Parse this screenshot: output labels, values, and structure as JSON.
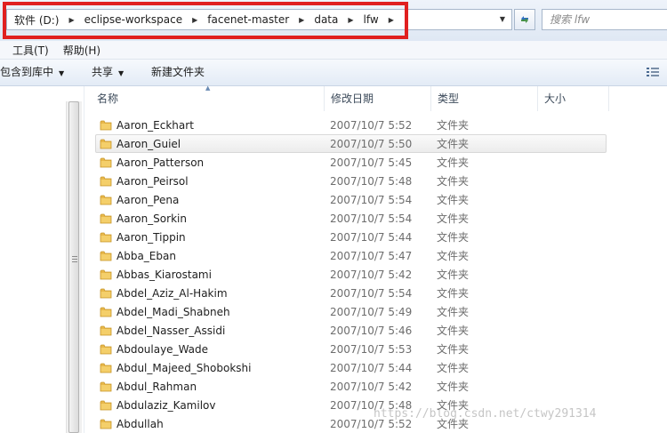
{
  "address_bar": {
    "breadcrumbs": [
      "软件 (D:)",
      "eclipse-workspace",
      "facenet-master",
      "data",
      "lfw"
    ]
  },
  "search": {
    "placeholder": "搜索 lfw"
  },
  "menu": {
    "items": [
      "工具(T)",
      "帮助(H)"
    ]
  },
  "toolbar": {
    "include_library": "包含到库中",
    "share": "共享",
    "new_folder": "新建文件夹"
  },
  "columns": {
    "name": "名称",
    "date": "修改日期",
    "type": "类型",
    "size": "大小"
  },
  "files": [
    {
      "name": "Aaron_Eckhart",
      "date": "2007/10/7 5:52",
      "type": "文件夹"
    },
    {
      "name": "Aaron_Guiel",
      "date": "2007/10/7 5:50",
      "type": "文件夹"
    },
    {
      "name": "Aaron_Patterson",
      "date": "2007/10/7 5:45",
      "type": "文件夹"
    },
    {
      "name": "Aaron_Peirsol",
      "date": "2007/10/7 5:48",
      "type": "文件夹"
    },
    {
      "name": "Aaron_Pena",
      "date": "2007/10/7 5:54",
      "type": "文件夹"
    },
    {
      "name": "Aaron_Sorkin",
      "date": "2007/10/7 5:54",
      "type": "文件夹"
    },
    {
      "name": "Aaron_Tippin",
      "date": "2007/10/7 5:44",
      "type": "文件夹"
    },
    {
      "name": "Abba_Eban",
      "date": "2007/10/7 5:47",
      "type": "文件夹"
    },
    {
      "name": "Abbas_Kiarostami",
      "date": "2007/10/7 5:42",
      "type": "文件夹"
    },
    {
      "name": "Abdel_Aziz_Al-Hakim",
      "date": "2007/10/7 5:54",
      "type": "文件夹"
    },
    {
      "name": "Abdel_Madi_Shabneh",
      "date": "2007/10/7 5:49",
      "type": "文件夹"
    },
    {
      "name": "Abdel_Nasser_Assidi",
      "date": "2007/10/7 5:46",
      "type": "文件夹"
    },
    {
      "name": "Abdoulaye_Wade",
      "date": "2007/10/7 5:53",
      "type": "文件夹"
    },
    {
      "name": "Abdul_Majeed_Shobokshi",
      "date": "2007/10/7 5:44",
      "type": "文件夹"
    },
    {
      "name": "Abdul_Rahman",
      "date": "2007/10/7 5:42",
      "type": "文件夹"
    },
    {
      "name": "Abdulaziz_Kamilov",
      "date": "2007/10/7 5:48",
      "type": "文件夹"
    },
    {
      "name": "Abdullah",
      "date": "2007/10/7 5:52",
      "type": "文件夹"
    }
  ],
  "hovered_index": 1,
  "watermark": "https://blog.csdn.net/ctwy291314",
  "colors": {
    "highlight_border": "#e02020",
    "folder": "#e8b84a",
    "chrome_blue": "#dfe8f4"
  }
}
